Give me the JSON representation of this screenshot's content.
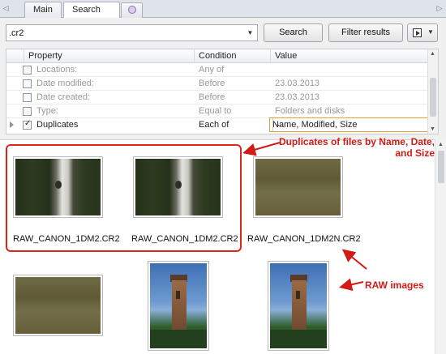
{
  "tabs": {
    "items": [
      {
        "label": "Main"
      },
      {
        "label": "Search"
      }
    ],
    "new_tab_icon": "new-tab-icon"
  },
  "search": {
    "value": ".cr2",
    "search_button": "Search",
    "filter_button": "Filter results"
  },
  "grid": {
    "columns": [
      "Property",
      "Condition",
      "Value"
    ],
    "rows": [
      {
        "property": "Locations:",
        "condition": "Any of",
        "value": "",
        "checked": false
      },
      {
        "property": "Date modified:",
        "condition": "Before",
        "value": "23.03.2013",
        "checked": false
      },
      {
        "property": "Date created:",
        "condition": "Before",
        "value": "23.03.2013",
        "checked": false
      },
      {
        "property": "Type:",
        "condition": "Equal to",
        "value": "Folders and disks",
        "checked": false
      },
      {
        "property": "Duplicates",
        "condition": "Each of",
        "value": "Name, Modified, Size",
        "checked": true
      }
    ],
    "ellipsis": "..."
  },
  "results": {
    "files": [
      {
        "name": "RAW_CANON_1DM2.CR2",
        "image": "birch-trunk"
      },
      {
        "name": "RAW_CANON_1DM2.CR2",
        "image": "birch-trunk"
      },
      {
        "name": "RAW_CANON_1DM2N.CR2",
        "image": "grass"
      },
      {
        "name": "",
        "image": "grass"
      },
      {
        "name": "",
        "image": "church-tower"
      },
      {
        "name": "",
        "image": "church-tower"
      }
    ]
  },
  "annotations": {
    "duplicates_note_line1": "Duplicates of files by Name, Date,",
    "duplicates_note_line2": "and Size",
    "raw_note": "RAW images",
    "color": "#d41a14"
  }
}
